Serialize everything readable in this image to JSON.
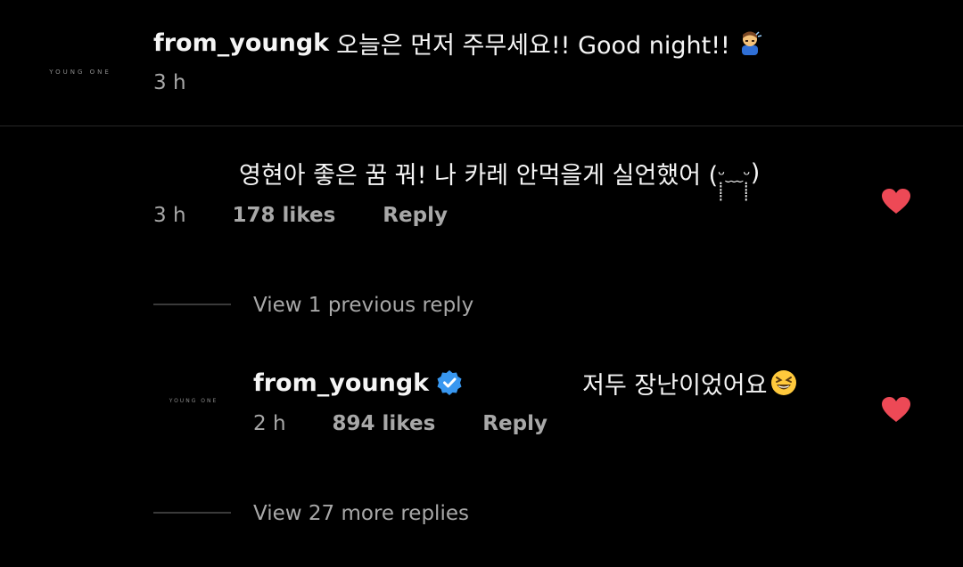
{
  "colors": {
    "background": "#000000",
    "text": "#f5f5f5",
    "secondary_text": "#a8a8a8",
    "divider": "#262626",
    "thread_line": "#3a3a3a",
    "heart": "#ed4956",
    "verified": "#3897f0"
  },
  "caption": {
    "avatar_text": "YOUNG ONE",
    "username": "from_youngk",
    "text": "오늘은 먼저 주무세요!! Good night!!",
    "emoji": "person-bowing-emoji",
    "time": "3 h"
  },
  "comment": {
    "text": "영현아 좋은 꿈 꿔",
    "text_rest": "! 나 카레 안먹을게 실언했어 (",
    "kaomoji_inner": "ᵕ̣̣̣̣̣̣﹏ᵕ̣̣̣̣̣̣",
    "text_end": ")",
    "time": "3 h",
    "likes": "178 likes",
    "reply": "Reply",
    "liked_icon": "heart-filled-icon"
  },
  "thread1": {
    "label": "View 1 previous reply"
  },
  "reply": {
    "avatar_text": "YOUNG ONE",
    "username": "from_youngk",
    "verified_icon": "verified-badge-icon",
    "text": "저두 장난이었어요",
    "emoji": "grinning-squinting-face-emoji",
    "time": "2 h",
    "likes": "894 likes",
    "reply": "Reply",
    "liked_icon": "heart-filled-icon"
  },
  "thread2": {
    "label": "View 27 more replies"
  }
}
